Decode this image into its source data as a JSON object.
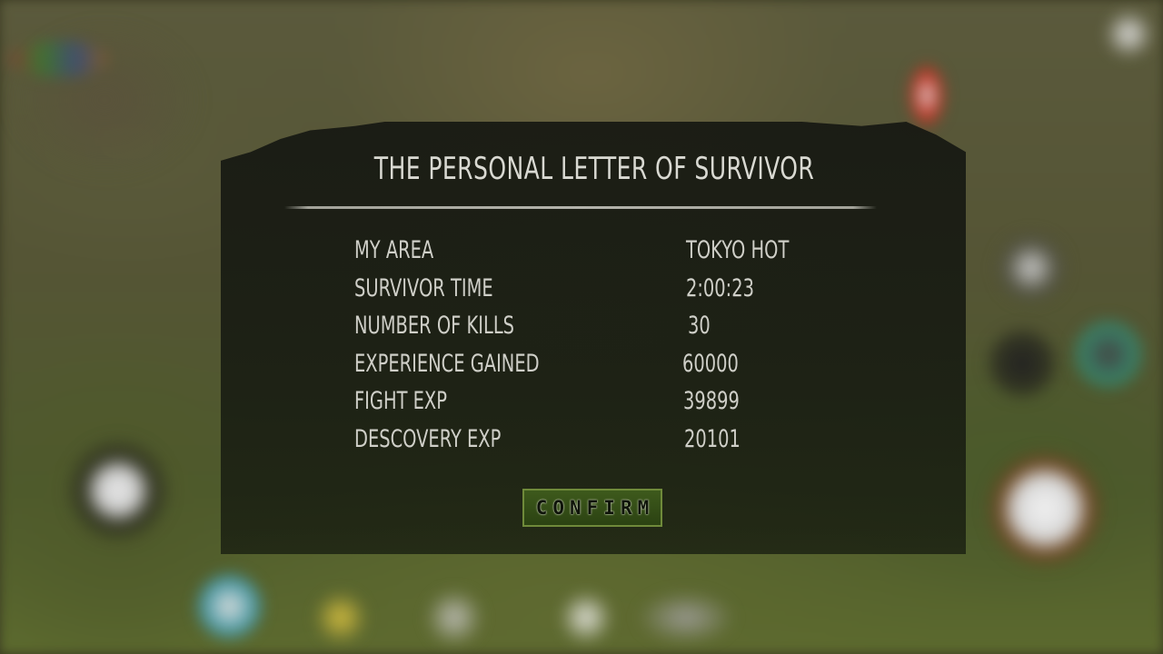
{
  "dialog": {
    "title": "THE PERSONAL LETTER OF SURVIVOR",
    "rows": [
      {
        "label": "MY AREA",
        "value": "TOKYO HOT"
      },
      {
        "label": "SURVIVOR TIME",
        "value": "2:00:23"
      },
      {
        "label": "NUMBER OF KILLS",
        "value": "30"
      },
      {
        "label": "EXPERIENCE GAINED",
        "value": "60000"
      },
      {
        "label": "FIGHT EXP",
        "value": "39899"
      },
      {
        "label": "DESCOVERY EXP",
        "value": "20101"
      }
    ],
    "confirm_label": "CONFIRM"
  },
  "colors": {
    "text": "#cfcfc8",
    "button_border": "#6f8a3a",
    "button_fill": "#34501a",
    "panel": "#1a1d14"
  }
}
